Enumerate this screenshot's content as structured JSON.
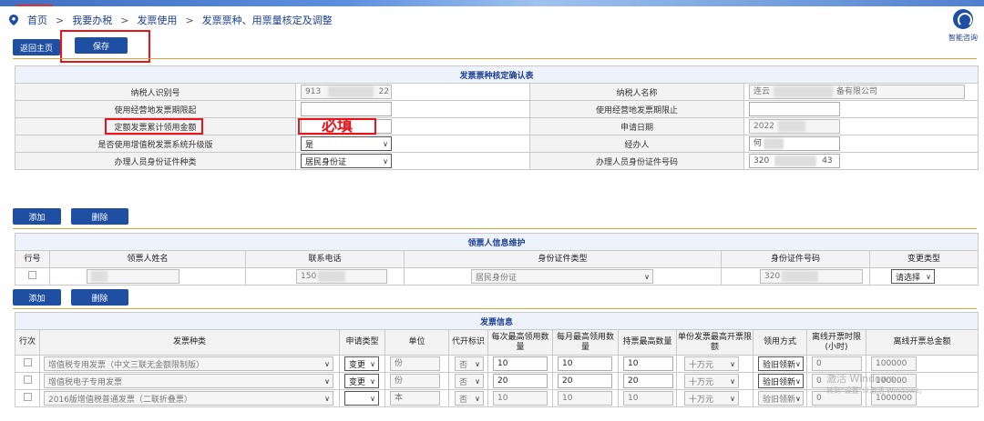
{
  "breadcrumb": {
    "items": [
      "首页",
      "我要办税",
      "发票使用",
      "发票票种、用票量核定及调整"
    ],
    "sep": ">"
  },
  "help": {
    "label": "智能咨询"
  },
  "toolbar": {
    "back": "返回主页",
    "save": "保存"
  },
  "confirm_table": {
    "title": "发票票种核定确认表",
    "rows": [
      {
        "l1": "纳税人识别号",
        "v1a": "913",
        "v1b": "22",
        "l2": "纳税人名称",
        "v2a": "连云",
        "v2b": "备有限公司"
      },
      {
        "l1": "使用经营地发票期限起",
        "v1a": "",
        "l2": "使用经营地发票期限止",
        "v2a": ""
      },
      {
        "l1": "定额发票累计领用金额",
        "v1a": "必填",
        "l2": "申请日期",
        "v2a": "2022"
      },
      {
        "l1": "是否使用增值税发票系统升级版",
        "v1a": "是",
        "l2": "经办人",
        "v2a": "何"
      },
      {
        "l1": "办理人员身份证件种类",
        "v1a": "居民身份证",
        "l2": "办理人员身份证件号码",
        "v2a": "320",
        "v2b": "43"
      }
    ]
  },
  "actions1": {
    "add": "添加",
    "del": "删除"
  },
  "receiver": {
    "title": "领票人信息维护",
    "headers": [
      "行号",
      "领票人姓名",
      "联系电话",
      "身份证件类型",
      "身份证件号码",
      "变更类型"
    ],
    "row": {
      "name": "",
      "phone": "150",
      "idtype": "居民身份证",
      "idno": "320",
      "change": "请选择"
    }
  },
  "actions2": {
    "add": "添加",
    "del": "删除"
  },
  "invoice": {
    "title": "发票信息",
    "headers": [
      "行次",
      "发票种类",
      "申请类型",
      "单位",
      "代开标识",
      "每次最高领用数量",
      "每月最高领用数量",
      "持票最高数量",
      "单份发票最高开票限额",
      "领用方式",
      "离线开票时限(小时)",
      "离线开票总金额"
    ],
    "rows": [
      {
        "type": "增值税专用发票（中文三联无金额限制版）",
        "apply": "变更",
        "unit": "份",
        "agent": "否",
        "per": "10",
        "month": "10",
        "hold": "10",
        "limit": "十万元",
        "mode": "验旧领新",
        "hours": "0",
        "total": "100000"
      },
      {
        "type": "增值税电子专用发票",
        "apply": "变更",
        "unit": "份",
        "agent": "否",
        "per": "20",
        "month": "20",
        "hold": "20",
        "limit": "十万元",
        "mode": "验旧领新",
        "hours": "0",
        "total": "100000"
      },
      {
        "type": "2016版增值税普通发票（二联折叠票）",
        "apply": "",
        "unit": "本",
        "agent": "否",
        "per": "10",
        "month": "10",
        "hold": "10",
        "limit": "十万元",
        "mode": "验旧领新",
        "hours": "0",
        "total": "1000000"
      }
    ]
  },
  "watermark": {
    "line1": "激活 Windows",
    "line2": "转到\"设置\"以激活 Windows。"
  },
  "colors": {
    "primary": "#1f4fa3",
    "highlight": "#e8141a",
    "header_bg": "#eef3fb"
  }
}
